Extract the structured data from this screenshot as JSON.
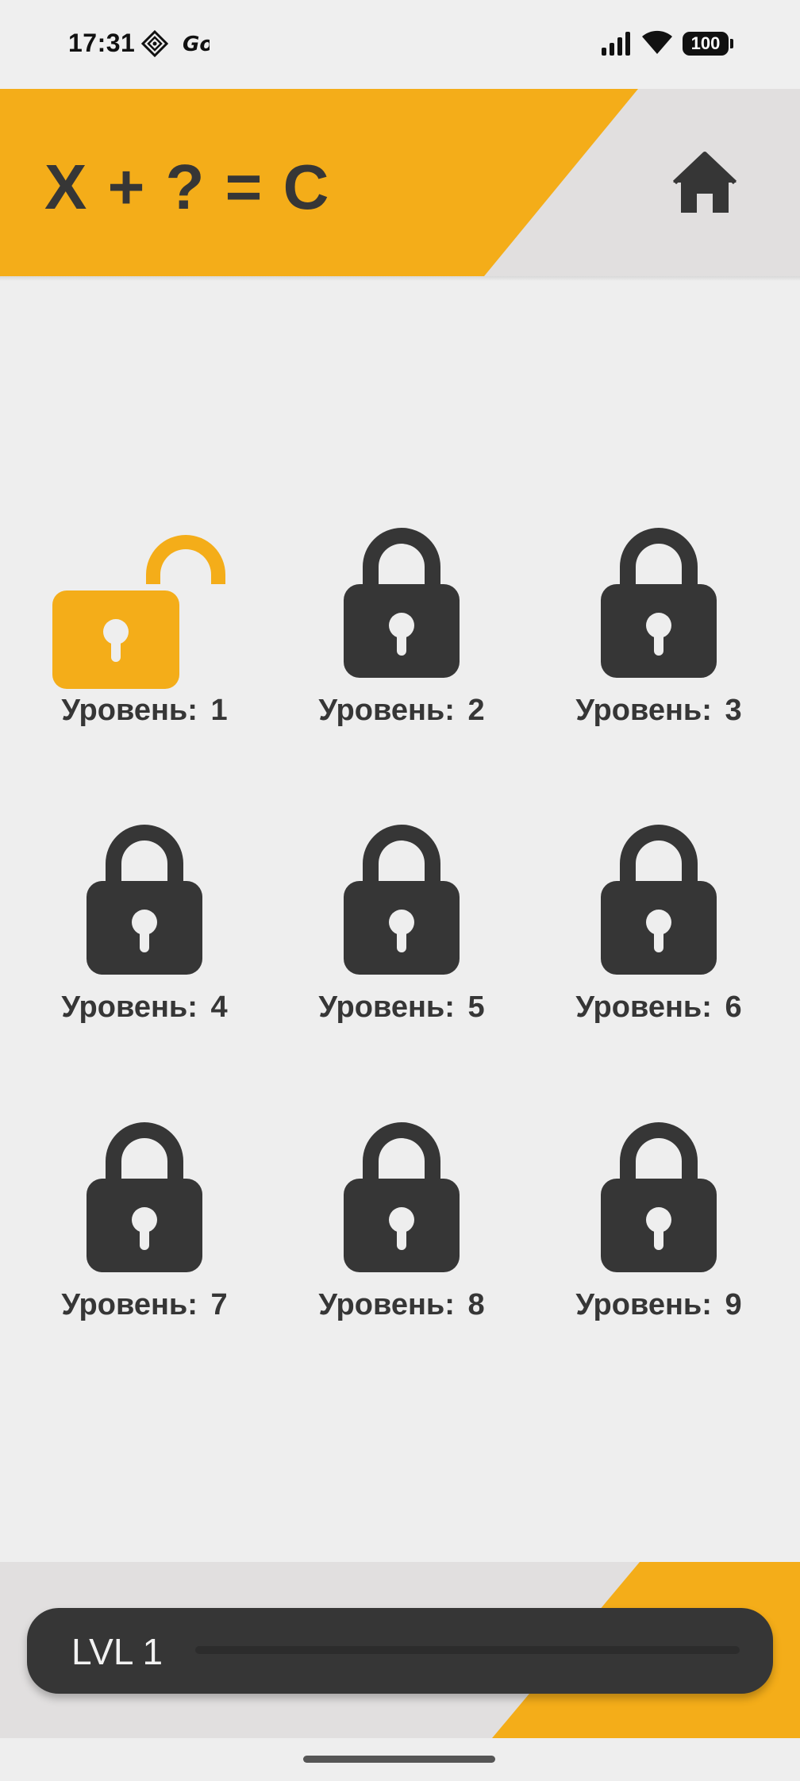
{
  "status_bar": {
    "time": "17:31",
    "battery": "100",
    "icons": [
      "diamond-app-icon",
      "go-app-icon",
      "signal-icon",
      "wifi-icon",
      "battery-icon"
    ]
  },
  "header": {
    "title": "X + ? = C",
    "home_icon": "home-icon"
  },
  "levels": [
    {
      "label": "Уровень: 1",
      "state": "unlocked"
    },
    {
      "label": "Уровень: 2",
      "state": "locked"
    },
    {
      "label": "Уровень: 3",
      "state": "locked"
    },
    {
      "label": "Уровень: 4",
      "state": "locked"
    },
    {
      "label": "Уровень: 5",
      "state": "locked"
    },
    {
      "label": "Уровень: 6",
      "state": "locked"
    },
    {
      "label": "Уровень: 7",
      "state": "locked"
    },
    {
      "label": "Уровень: 8",
      "state": "locked"
    },
    {
      "label": "Уровень: 9",
      "state": "locked"
    }
  ],
  "footer": {
    "level_label": "LVL 1",
    "progress": 0
  },
  "colors": {
    "accent": "#f4ad19",
    "dark": "#363636",
    "background": "#eeeeee",
    "panel_gray": "#e1dfdf"
  }
}
